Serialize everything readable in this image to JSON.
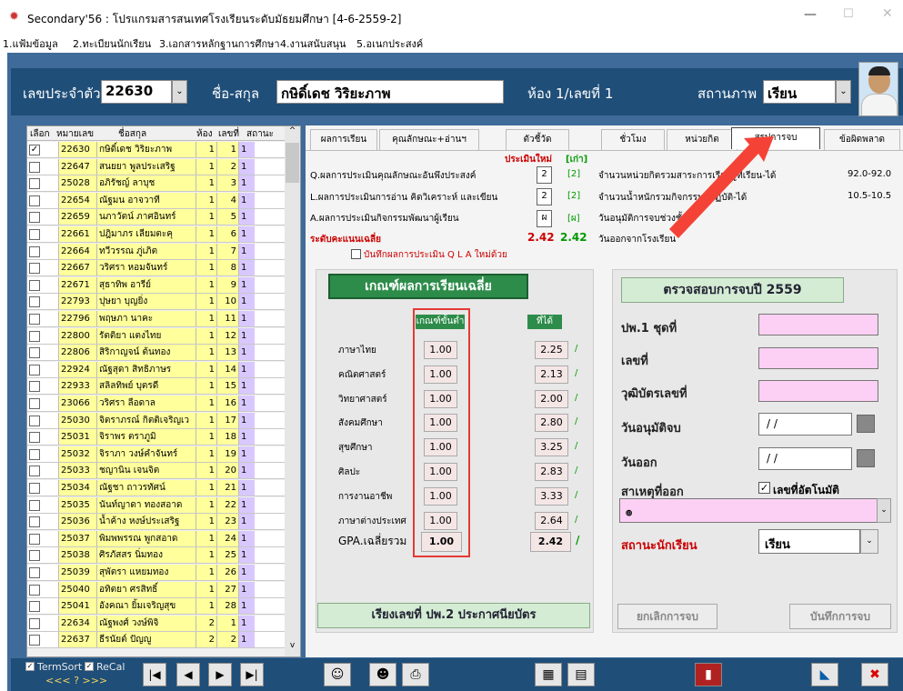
{
  "window": {
    "title": "Secondary'56 : โปรแกรมสารสนเทศโรงเรียนระดับมัธยมศึกษา [4-6-2559-2]"
  },
  "menu": [
    "1.แฟ้มข้อมูล",
    "2.ทะเบียนนักเรียน",
    "3.เอกสารหลักฐานการศึกษา",
    "4.งานสนับสนุน",
    "5.อเนกประสงค์"
  ],
  "header": {
    "id_label": "เลขประจำตัว",
    "id_value": "22630",
    "name_label": "ชื่อ-สกุล",
    "name_value": "กษิดิ์เดช วิริยะภาพ",
    "room_label": "ห้อง 1/เลขที่ 1",
    "status_label": "สถานภาพ",
    "status_value": "เรียน"
  },
  "list": {
    "headers": [
      "เลือก",
      "หมายเลข",
      "ชื่อสกุล",
      "ห้อง",
      "เลขที่",
      "สถานะ"
    ],
    "rows": [
      [
        "22630",
        "กษิดิ์เดช วิริยะภาพ",
        "1",
        "1",
        "1",
        true
      ],
      [
        "22647",
        "สนยยา พูลประเสริฐ",
        "1",
        "2",
        "1",
        false
      ],
      [
        "25028",
        "อภิรัชญ์ ลาบุช",
        "1",
        "3",
        "1",
        false
      ],
      [
        "22654",
        "ณัฐมน อาจวาที",
        "1",
        "4",
        "1",
        false
      ],
      [
        "22659",
        "นภาวัตน์ ภาศอินทร์",
        "1",
        "5",
        "1",
        false
      ],
      [
        "22661",
        "ปฎิมาภร เลียมตะคุ",
        "1",
        "6",
        "1",
        false
      ],
      [
        "22664",
        "ทวีวรรณ ภู่เภิต",
        "1",
        "7",
        "1",
        false
      ],
      [
        "22667",
        "วริศรา หอมจันทร์",
        "1",
        "8",
        "1",
        false
      ],
      [
        "22671",
        "สุธาทิพ อารีย์",
        "1",
        "9",
        "1",
        false
      ],
      [
        "22793",
        "ปุษยา บุญยิ่ง",
        "1",
        "10",
        "1",
        false
      ],
      [
        "22796",
        "พฤษภา นาคะ",
        "1",
        "11",
        "1",
        false
      ],
      [
        "22800",
        "รัตติยา แตงไทย",
        "1",
        "12",
        "1",
        false
      ],
      [
        "22806",
        "สิริกาญจน์ ต้นทอง",
        "1",
        "13",
        "1",
        false
      ],
      [
        "22924",
        "ณัฐสุดา สิทธิภาษร",
        "1",
        "14",
        "1",
        false
      ],
      [
        "22933",
        "สลิลทิพย์ บุตรดี",
        "1",
        "15",
        "1",
        false
      ],
      [
        "23066",
        "วริศรา ลือดาล",
        "1",
        "16",
        "1",
        false
      ],
      [
        "25030",
        "จิตราภรณ์ กิตติเจริญเว",
        "1",
        "17",
        "1",
        false
      ],
      [
        "25031",
        "จิราพร ตราภูมิ",
        "1",
        "18",
        "1",
        false
      ],
      [
        "25032",
        "จิราภา วงษ์คำจันทร์",
        "1",
        "19",
        "1",
        false
      ],
      [
        "25033",
        "ชญานิน เจนจิต",
        "1",
        "20",
        "1",
        false
      ],
      [
        "25034",
        "ณัฐชา ถาวรทัศน์",
        "1",
        "21",
        "1",
        false
      ],
      [
        "25035",
        "นันท์ญาดา ทองสอาด",
        "1",
        "22",
        "1",
        false
      ],
      [
        "25036",
        "น้ำค้าง หงษ์ประเสริฐ",
        "1",
        "23",
        "1",
        false
      ],
      [
        "25037",
        "พิมพพรรณ พูกสอาด",
        "1",
        "24",
        "1",
        false
      ],
      [
        "25038",
        "ศิรภัสสร นิ่มทอง",
        "1",
        "25",
        "1",
        false
      ],
      [
        "25039",
        "สุพัตรา แหยมทอง",
        "1",
        "26",
        "1",
        false
      ],
      [
        "25040",
        "อทิตยา ศรสิทธิ์",
        "1",
        "27",
        "1",
        false
      ],
      [
        "25041",
        "อังคณา ยิ้มเจริญสุข",
        "1",
        "28",
        "1",
        false
      ],
      [
        "22634",
        "ณัฐพงศ์ วงษ์พิจิ",
        "2",
        "1",
        "1",
        false
      ],
      [
        "22637",
        "ธีรนัยต์ ปัญญู",
        "2",
        "2",
        "1",
        false
      ]
    ]
  },
  "tabs": [
    "ผลการเรียน",
    "คุณลักษณะ+อ่านฯ",
    "ตัวชี้วัด",
    "ชั่วโมง",
    "หน่วยกิต",
    "สรุปการจบ",
    "ข้อผิดพลาด"
  ],
  "assess": {
    "new_label": "ประเมินใหม่",
    "old_label": "[เก่า]",
    "rows": [
      {
        "label": "Q.ผลการประเมินคุณลักษณะอันพึงประสงค์",
        "new": "2",
        "old": "[2]"
      },
      {
        "label": "L.ผลการประเมินการอ่าน คิดวิเคราะห์ และเขียน",
        "new": "2",
        "old": "[2]"
      },
      {
        "label": "A.ผลการประเมินกิจกรรมพัฒนาผู้เรียน",
        "new": "ผ",
        "old": "[ผ]"
      }
    ],
    "gpa_label": "ระดับคะแนนเฉลี่ย",
    "gpa_new": "2.42",
    "gpa_old": "2.42",
    "save_qla": "บันทึกผลการประเมิน Q L A ใหม่ด้วย"
  },
  "credits": [
    {
      "label": "จำนวนหน่วยกิตรวมสาระการเรียนรู้ที่เรียน-ได้",
      "value": "92.0-92.0"
    },
    {
      "label": "จำนวนน้ำหนักรวมกิจกรรมที่ปฏิบัติ-ได้",
      "value": "10.5-10.5"
    },
    {
      "label": "วันอนุมัติการจบช่วงชั้น",
      "value": ""
    },
    {
      "label": "วันออกจากโรงเรียน",
      "value": ""
    }
  ],
  "grades": {
    "title": "เกณฑ์ผลการเรียนเฉลี่ย",
    "min_header": "เกณฑ์ขั้นต่ำ",
    "got_header": "ที่ได้",
    "subjects": [
      {
        "name": "ภาษาไทย",
        "min": "1.00",
        "got": "2.25"
      },
      {
        "name": "คณิตศาสตร์",
        "min": "1.00",
        "got": "2.13"
      },
      {
        "name": "วิทยาศาสตร์",
        "min": "1.00",
        "got": "2.00"
      },
      {
        "name": "สังคมศึกษา",
        "min": "1.00",
        "got": "2.80"
      },
      {
        "name": "สุขศึกษา",
        "min": "1.00",
        "got": "3.25"
      },
      {
        "name": "ศิลปะ",
        "min": "1.00",
        "got": "2.83"
      },
      {
        "name": "การงานอาชีพ",
        "min": "1.00",
        "got": "3.33"
      },
      {
        "name": "ภาษาต่างประเทศ",
        "min": "1.00",
        "got": "2.64"
      }
    ],
    "gpa_label": "GPA.เฉลี่ยรวม",
    "gpa_min": "1.00",
    "gpa_got": "2.42",
    "order_button": "เรียงเลขที่ ปพ.2 ประกาศนียบัตร"
  },
  "graduate": {
    "title": "ตรวจสอบการจบปี 2559",
    "pp1_label": "ปพ.1 ชุดที่",
    "no_label": "เลขที่",
    "cert_label": "วุฒิบัตรเลขที่",
    "approve_label": "วันอนุมัติจบ",
    "approve_value": "/ /",
    "out_label": "วันออก",
    "out_value": "/ /",
    "reason_label": "สาเหตุที่ออก",
    "auto_no_label": "เลขที่อัตโนมัติ",
    "reason_value": "๏",
    "status_label": "สถานะนักเรียน",
    "status_value": "เรียน",
    "cancel_button": "ยกเลิกการจบ",
    "save_button": "บันทึกการจบ"
  },
  "bottom": {
    "termsort": "TermSort",
    "recal": "ReCal",
    "nav_hint": "<<< ? >>>"
  }
}
